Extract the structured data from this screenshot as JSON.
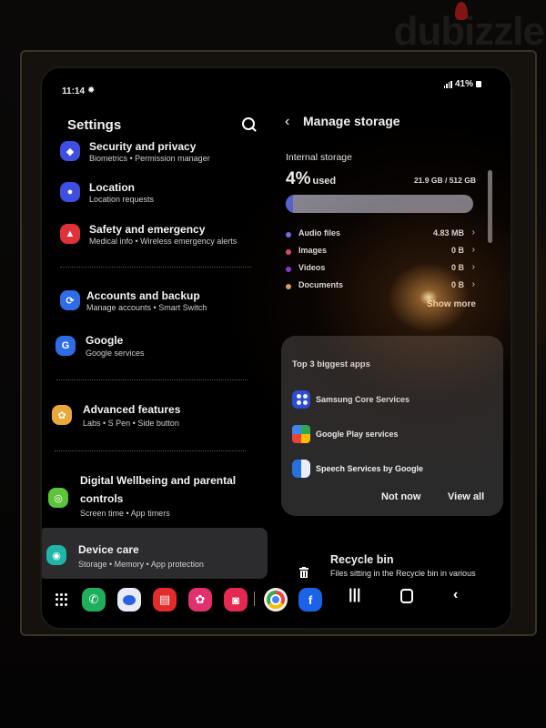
{
  "watermark": "dubizzle",
  "status": {
    "time": "11:14",
    "battery": "41%"
  },
  "settings": {
    "title": "Settings",
    "items": [
      {
        "title": "Security and privacy",
        "subtitle": "Biometrics  •  Permission manager",
        "icon": "shield-icon",
        "color": "#3d4ee0"
      },
      {
        "title": "Location",
        "subtitle": "Location requests",
        "icon": "location-pin-icon",
        "color": "#3d4ee0"
      },
      {
        "title": "Safety and emergency",
        "subtitle": "Medical info  •  Wireless emergency alerts",
        "icon": "siren-icon",
        "color": "#e0303a"
      },
      {
        "title": "Accounts and backup",
        "subtitle": "Manage accounts  •  Smart Switch",
        "icon": "sync-icon",
        "color": "#2e6de6"
      },
      {
        "title": "Google",
        "subtitle": "Google services",
        "icon": "google-g-icon",
        "color": "#2e6de6"
      },
      {
        "title": "Advanced features",
        "subtitle": "Labs  •  S Pen  •  Side button",
        "icon": "gear-flower-icon",
        "color": "#e8a83a"
      },
      {
        "title": "Digital Wellbeing and parental controls",
        "title_line1": "Digital Wellbeing and parental",
        "title_line2": "controls",
        "subtitle": "Screen time  •  App timers",
        "icon": "wellbeing-icon",
        "color": "#5cc43a"
      },
      {
        "title": "Device care",
        "subtitle": "Storage  •  Memory  •  App protection",
        "icon": "device-care-icon",
        "color": "#1fb5a8",
        "selected": true
      }
    ]
  },
  "manage_storage": {
    "title": "Manage storage",
    "section": "Internal storage",
    "percent_used": "4%",
    "used_word": "used",
    "used_fraction": 0.04,
    "capacity": "21.9 GB / 512 GB",
    "categories": [
      {
        "name": "Audio files",
        "value": "4.83 MB",
        "color": "#6f78e8"
      },
      {
        "name": "Images",
        "value": "0 B",
        "color": "#e8507a"
      },
      {
        "name": "Videos",
        "value": "0 B",
        "color": "#8a3ee0"
      },
      {
        "name": "Documents",
        "value": "0 B",
        "color": "#e8b060"
      }
    ],
    "show_more": "Show more",
    "top_apps": {
      "title": "Top 3 biggest apps",
      "apps": [
        {
          "name": "Samsung Core Services",
          "icon": "samsung-core-icon"
        },
        {
          "name": "Google Play services",
          "icon": "play-services-icon"
        },
        {
          "name": "Speech Services by Google",
          "icon": "speech-services-icon"
        }
      ],
      "not_now": "Not now",
      "view_all": "View all"
    },
    "recycle_bin": {
      "title": "Recycle bin",
      "subtitle": "Files sitting in the Recycle bin in various"
    }
  },
  "taskbar": {
    "apps": [
      {
        "name": "phone",
        "color": "#1fae5c"
      },
      {
        "name": "messages",
        "color": "#e8eaf5"
      },
      {
        "name": "notes",
        "color": "#e52a2a"
      },
      {
        "name": "gallery",
        "color": "#e0306e"
      },
      {
        "name": "camera",
        "color": "#e52a52"
      },
      {
        "name": "chrome",
        "color": "#f0f0f0"
      },
      {
        "name": "facebook",
        "color": "#1b62e6"
      }
    ]
  }
}
